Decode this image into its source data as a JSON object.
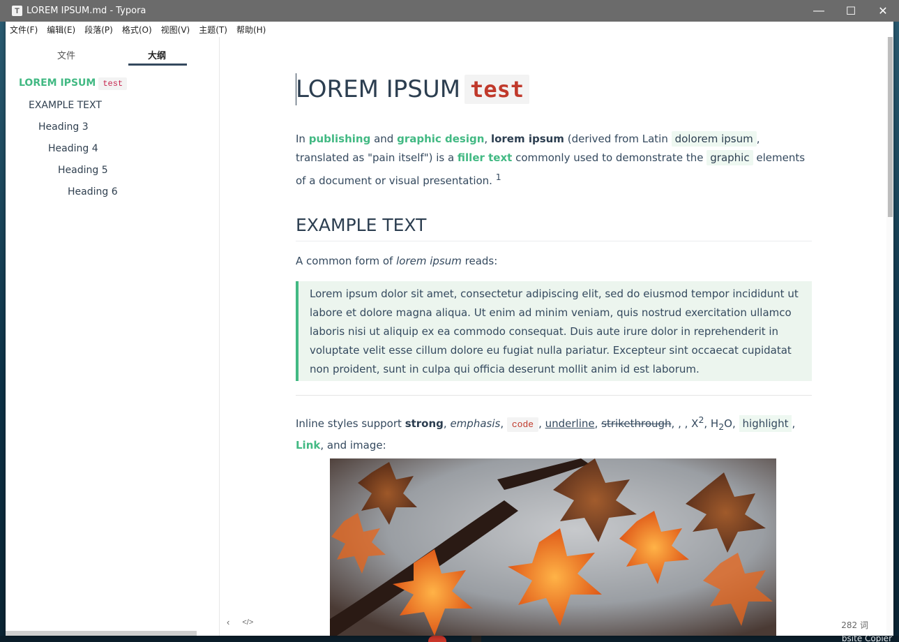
{
  "window": {
    "title": "LOREM IPSUM.md - Typora",
    "app_icon": "T",
    "controls": {
      "minimize": "—",
      "maximize": "☐",
      "close": "✕"
    }
  },
  "menu": [
    {
      "label": "文件(F)"
    },
    {
      "label": "编辑(E)"
    },
    {
      "label": "段落(P)"
    },
    {
      "label": "格式(O)"
    },
    {
      "label": "视图(V)"
    },
    {
      "label": "主题(T)"
    },
    {
      "label": "帮助(H)"
    }
  ],
  "sidebar": {
    "tabs": {
      "files": "文件",
      "outline": "大纲"
    },
    "outline": [
      {
        "label": "LOREM IPSUM",
        "code": "test"
      },
      {
        "label": "EXAMPLE TEXT"
      },
      {
        "label": "Heading 3"
      },
      {
        "label": "Heading 4"
      },
      {
        "label": "Heading 5"
      },
      {
        "label": "Heading 6"
      }
    ]
  },
  "footer": {
    "prev_icon": "‹",
    "source_icon": "</>",
    "word_count": "282 词"
  },
  "document": {
    "h1": {
      "text": "LOREM IPSUM",
      "code": "test"
    },
    "intro": {
      "t1": "In ",
      "link1": "publishing",
      "t2": " and ",
      "link2": "graphic design",
      "t3": ", ",
      "bold1": "lorem ipsum",
      "t4": " (derived from Latin ",
      "code1": "dolorem ipsum",
      "t5": ", translated as \"pain itself\") is a ",
      "link3": "filler text",
      "t6": " commonly used to demonstrate the ",
      "code2": "graphic",
      "t7": " elements of a document or visual presentation. ",
      "footnote": "1"
    },
    "h2": "EXAMPLE TEXT",
    "common": {
      "t1": "A common form of ",
      "em": "lorem ipsum",
      "t2": " reads:"
    },
    "quote": "Lorem ipsum dolor sit amet, consectetur adipiscing elit, sed do eiusmod tempor incididunt ut labore et dolore magna aliqua. Ut enim ad minim veniam, quis nostrud exercitation ullamco laboris nisi ut aliquip ex ea commodo consequat. Duis aute irure dolor in reprehenderit in voluptate velit esse cillum dolore eu fugiat nulla pariatur. Excepteur sint occaecat cupidatat non proident, sunt in culpa qui officia deserunt mollit anim id est laborum.",
    "inline": {
      "t1": "Inline styles support ",
      "strong": "strong",
      "c1": ", ",
      "em": "emphasis",
      "c2": ", ",
      "code": "code",
      "c3": ", ",
      "underline": "underline",
      "c4": ", ",
      "strike": "strikethrough",
      "c5": ", , , X",
      "sup": "2",
      "c6": ", H",
      "sub": "2",
      "c7": "O, ",
      "highlight": "highlight",
      "c8": ", ",
      "link": "Link",
      "c9": ", and image:"
    }
  },
  "desktop": {
    "label": "bsite Copier"
  }
}
